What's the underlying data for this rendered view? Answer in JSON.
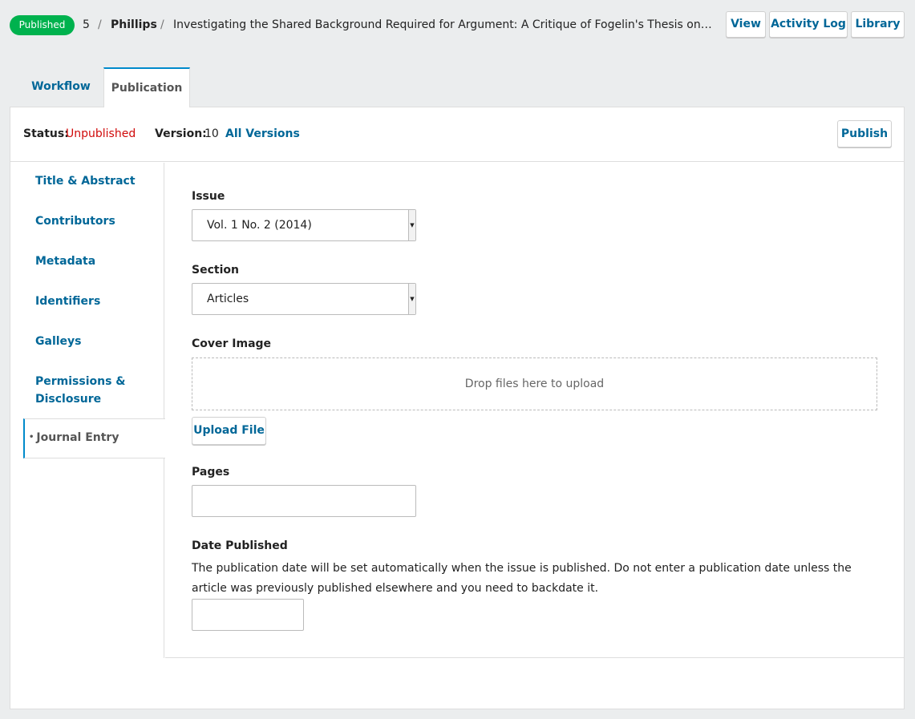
{
  "header": {
    "status_badge": "Published",
    "submission_id": "5",
    "separator": "/",
    "author": "Phillips",
    "title": "Investigating the Shared Background Required for Argument: A Critique of Fogelin's Thesis on Deep …",
    "buttons": {
      "view": "View",
      "activity_log": "Activity Log",
      "library": "Library"
    }
  },
  "tabs": [
    {
      "label": "Workflow"
    },
    {
      "label": "Publication"
    }
  ],
  "status_bar": {
    "status_label": "Status:",
    "status_value": "Unpublished",
    "version_label": "Version:",
    "version_value": "10",
    "all_versions": "All Versions",
    "publish": "Publish"
  },
  "sidebar": {
    "items": [
      {
        "label": "Title & Abstract"
      },
      {
        "label": "Contributors"
      },
      {
        "label": "Metadata"
      },
      {
        "label": "Identifiers"
      },
      {
        "label": "Galleys"
      },
      {
        "label": "Permissions & Disclosure"
      },
      {
        "label": "Journal Entry"
      }
    ],
    "active_marker": "•"
  },
  "form": {
    "issue_label": "Issue",
    "issue_value": "Vol. 1 No. 2 (2014)",
    "section_label": "Section",
    "section_value": "Articles",
    "cover_label": "Cover Image",
    "dropzone_text": "Drop files here to upload",
    "upload_button": "Upload File",
    "pages_label": "Pages",
    "pages_value": "",
    "date_label": "Date Published",
    "date_help": "The publication date will be set automatically when the issue is published. Do not enter a publication date unless the article was previously published elsewhere and you need to backdate it.",
    "date_value": ""
  },
  "colors": {
    "link": "#006798",
    "badge": "#00b24e",
    "unpublished": "#d00a0a",
    "active_border": "#008acb"
  }
}
